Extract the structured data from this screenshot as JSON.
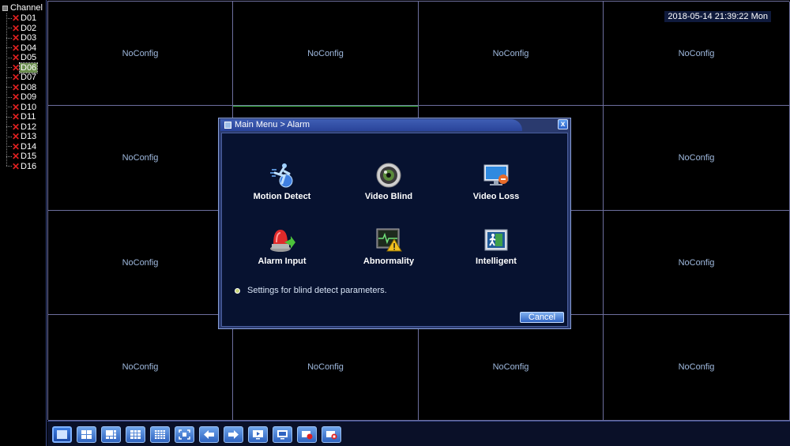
{
  "sidebar": {
    "root_label": "Channel",
    "channels": [
      "D01",
      "D02",
      "D03",
      "D04",
      "D05",
      "D06",
      "D07",
      "D08",
      "D09",
      "D10",
      "D11",
      "D12",
      "D13",
      "D14",
      "D15",
      "D16"
    ],
    "selected": "D06"
  },
  "grid": {
    "cells": [
      "NoConfig",
      "NoConfig",
      "NoConfig",
      "NoConfig",
      "NoConfig",
      "",
      "",
      "NoConfig",
      "NoConfig",
      "",
      "",
      "NoConfig",
      "NoConfig",
      "NoConfig",
      "NoConfig",
      "NoConfig"
    ]
  },
  "datetime": "2018-05-14 21:39:22 Mon",
  "dialog": {
    "title": "Main Menu > Alarm",
    "close_glyph": "x",
    "items": [
      {
        "label": "Motion Detect",
        "icon": "motion-detect-icon"
      },
      {
        "label": "Video Blind",
        "icon": "video-blind-icon"
      },
      {
        "label": "Video Loss",
        "icon": "video-loss-icon"
      },
      {
        "label": "Alarm Input",
        "icon": "alarm-input-icon"
      },
      {
        "label": "Abnormality",
        "icon": "abnormality-icon"
      },
      {
        "label": "Intelligent",
        "icon": "intelligent-icon"
      }
    ],
    "hint": "Settings for blind detect parameters.",
    "cancel_label": "Cancel"
  },
  "toolbar": {
    "buttons": [
      "single-view-icon",
      "quad-view-icon",
      "six-view-icon",
      "nine-view-icon",
      "sixteen-view-icon",
      "fullscreen-icon",
      "previous-icon",
      "next-icon",
      "playback-icon",
      "monitor-icon",
      "record-icon",
      "stop-record-icon"
    ]
  }
}
